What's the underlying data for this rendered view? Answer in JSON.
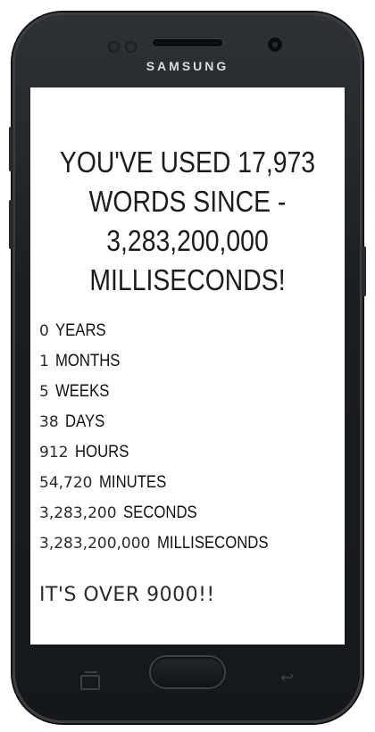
{
  "device": {
    "brand": "SAMSUNG"
  },
  "headline": "YOU'VE USED 17,973 WORDS SINCE - 3,283,200,000 MILLISECONDS!",
  "stats": [
    {
      "value": "0",
      "unit": "YEARS"
    },
    {
      "value": "1",
      "unit": "MONTHS"
    },
    {
      "value": "5",
      "unit": "WEEKS"
    },
    {
      "value": "38",
      "unit": "DAYS"
    },
    {
      "value": "912",
      "unit": "HOURS"
    },
    {
      "value": "54,720",
      "unit": "MINUTES"
    },
    {
      "value": "3,283,200",
      "unit": "SECONDS"
    },
    {
      "value": "3,283,200,000",
      "unit": "MILLISECONDS"
    }
  ],
  "footer_text": "IT'S OVER 9000!!",
  "icons": {
    "recent_apps": "recent-apps-icon",
    "home": "home-button",
    "back": "back-icon"
  },
  "colors": {
    "phone_body": "#1b1e21",
    "screen_bg": "#ffffff",
    "text": "#1c1c1c"
  }
}
